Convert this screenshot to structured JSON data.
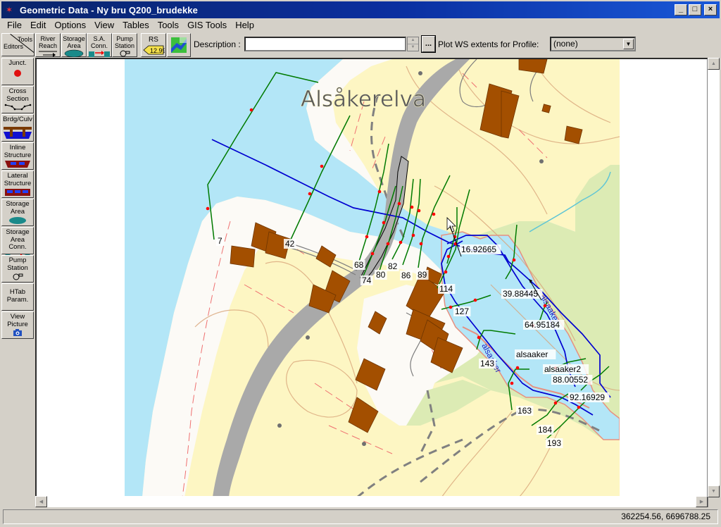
{
  "window": {
    "title": "Geometric Data - Ny bru Q200_brudekke",
    "controls": [
      "_",
      "□",
      "×"
    ]
  },
  "menu": [
    "File",
    "Edit",
    "Options",
    "View",
    "Tables",
    "Tools",
    "GIS Tools",
    "Help"
  ],
  "toolbar": {
    "corner_tools": "Tools",
    "corner_editors": "Editors",
    "buttons": [
      {
        "label1": "River",
        "label2": "Reach",
        "icon": "river-reach-arrow"
      },
      {
        "label1": "Storage",
        "label2": "Area",
        "icon": "storage-area-blob"
      },
      {
        "label1": "S.A.",
        "label2": "Conn.",
        "icon": "sa-connection"
      },
      {
        "label1": "Pump",
        "label2": "Station",
        "icon": "pump"
      },
      {
        "label1": "RS",
        "label2": "12.99",
        "icon": "river-station-tag"
      },
      {
        "label1": "",
        "label2": "",
        "icon": "gis-map"
      }
    ],
    "description_label": "Description :",
    "description_value": "",
    "ellipsis": "...",
    "plot_ws_label": "Plot WS extents for Profile:",
    "profile_selected": "(none)"
  },
  "sidebar": {
    "items": [
      {
        "l1": "Junct.",
        "l2": "",
        "icon": "junction"
      },
      {
        "l1": "Cross",
        "l2": "Section",
        "icon": "cross-section"
      },
      {
        "l1": "Brdg/Culv",
        "l2": "",
        "icon": "bridge-culvert"
      },
      {
        "l1": "Inline",
        "l2": "Structure",
        "icon": "inline-structure"
      },
      {
        "l1": "Lateral",
        "l2": "Structure",
        "icon": "lateral-structure"
      },
      {
        "l1": "Storage",
        "l2": "Area",
        "icon": "storage-area"
      },
      {
        "l1": "Storage",
        "l2": "Area Conn.",
        "icon": "storage-area-connection"
      },
      {
        "l1": "Pump",
        "l2": "Station",
        "icon": "pump-station"
      },
      {
        "l1": "HTab",
        "l2": "Param.",
        "icon": "htab"
      },
      {
        "l1": "View",
        "l2": "Picture",
        "icon": "camera"
      }
    ]
  },
  "map": {
    "place_label": "Alsåkerelva",
    "reach_labels": [
      "alsaaker",
      "alsaaker2",
      "alsaaker",
      "alsaaker"
    ],
    "cross_sections": [
      "7",
      "42",
      "68",
      "74",
      "80",
      "82",
      "86",
      "89",
      "114",
      "16.92665",
      "127",
      "39.88445",
      "64.95184",
      "143",
      "88.00552",
      "92.16929",
      "163",
      "184",
      "193"
    ],
    "colors": {
      "water": "#b3e6f7",
      "land_yellow": "#fdf6c3",
      "land_green": "#dcebb4",
      "building": "#a34f00",
      "road": "#a9a9a9",
      "reach": "#0000d0",
      "cross_section": "#007a00",
      "bank_point": "#ff0000"
    }
  },
  "status": {
    "coordinates": "362254.56, 6696788.25"
  }
}
